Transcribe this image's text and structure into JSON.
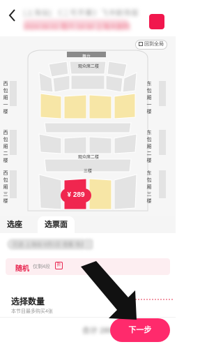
{
  "header": {
    "title_blurred": "[上海站] 《二号开幕》飞冲剧场版",
    "subtitle_blurred": "2024.06.01 周六 19:30 上海大剧院",
    "back_icon": "chevron-left-icon",
    "accent": "#f1174d"
  },
  "map": {
    "overview_button": "回到全局",
    "stage_label": "舞台",
    "side_left_1": "西包厢一楼",
    "side_right_1": "东包厢一楼",
    "side_left_2": "西包厢二楼",
    "side_right_2": "东包厢二楼",
    "side_left_3": "西包厢三楼",
    "side_right_3": "东包厢三楼",
    "tier1_label": "观众席二楼",
    "tier2_label": "观众席二楼",
    "tier3_label": "三楼",
    "price_bubble": "¥ 289",
    "colors": {
      "available": "#f7e6a6",
      "unavailable": "#e3e3e3",
      "selected": "#f0264f",
      "background": "#f6f6f6"
    }
  },
  "tabs": {
    "seat": "选座",
    "face": "选票面"
  },
  "selection": {
    "blurred_chip": "已选 上海站 6月1日 观看 场次",
    "random_title": "随机",
    "random_hint": "仅剩4段",
    "random_tag": "折"
  },
  "quantity": {
    "title": "选择数量",
    "note": "本节目最多购买4张"
  },
  "footer": {
    "price_blurred": "合计 289.00",
    "next_button": "下一步",
    "button_color": "#ff2a6c"
  }
}
